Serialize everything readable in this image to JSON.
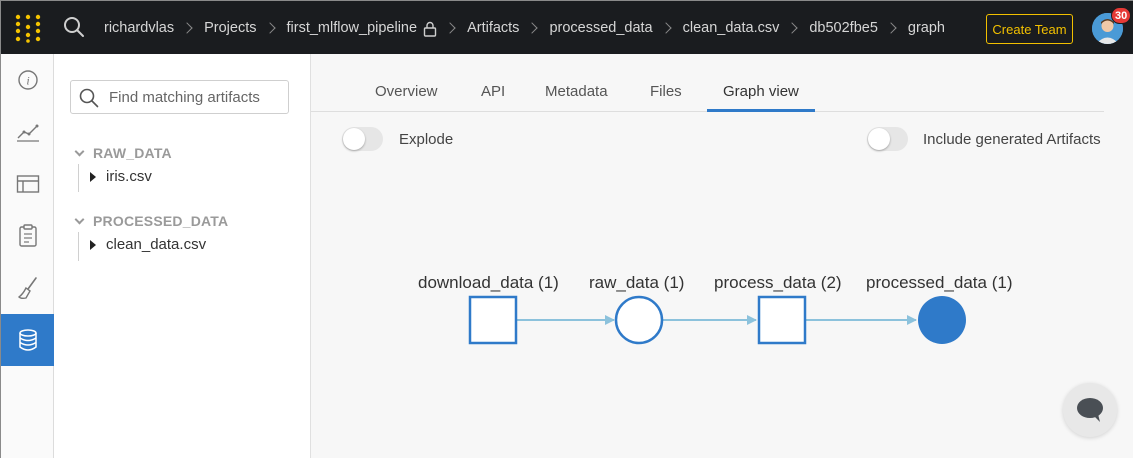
{
  "breadcrumbs": [
    "richardvlas",
    "Projects",
    "first_mlflow_pipeline",
    "Artifacts",
    "processed_data",
    "clean_data.csv",
    "db502fbe5",
    "graph"
  ],
  "topbar": {
    "create_team_label": "Create Team",
    "notification_count": "30"
  },
  "sidebar_rail": {
    "items": [
      "info-icon",
      "chart-icon",
      "table-icon",
      "clipboard-icon",
      "sweep-brush-icon",
      "database-icon"
    ],
    "active_index": 5
  },
  "artifacts_panel": {
    "search_placeholder": "Find matching artifacts",
    "groups": [
      {
        "title": "RAW_DATA",
        "items": [
          "iris.csv"
        ]
      },
      {
        "title": "PROCESSED_DATA",
        "items": [
          "clean_data.csv"
        ]
      }
    ]
  },
  "tabs": {
    "items": [
      "Overview",
      "API",
      "Metadata",
      "Files",
      "Graph view"
    ],
    "active": "Graph view"
  },
  "toggles": {
    "explode_label": "Explode",
    "include_generated_label": "Include generated Artifacts"
  },
  "graph": {
    "nodes": [
      {
        "label": "download_data (1)",
        "kind": "run"
      },
      {
        "label": "raw_data (1)",
        "kind": "artifact"
      },
      {
        "label": "process_data (2)",
        "kind": "run"
      },
      {
        "label": "processed_data (1)",
        "kind": "artifact-selected"
      }
    ]
  },
  "colors": {
    "accent": "#2f7ac9",
    "edge": "#8cc2dc",
    "topbar": "#1a1c1f",
    "create_team": "#f2c000",
    "badge": "#e53935"
  }
}
